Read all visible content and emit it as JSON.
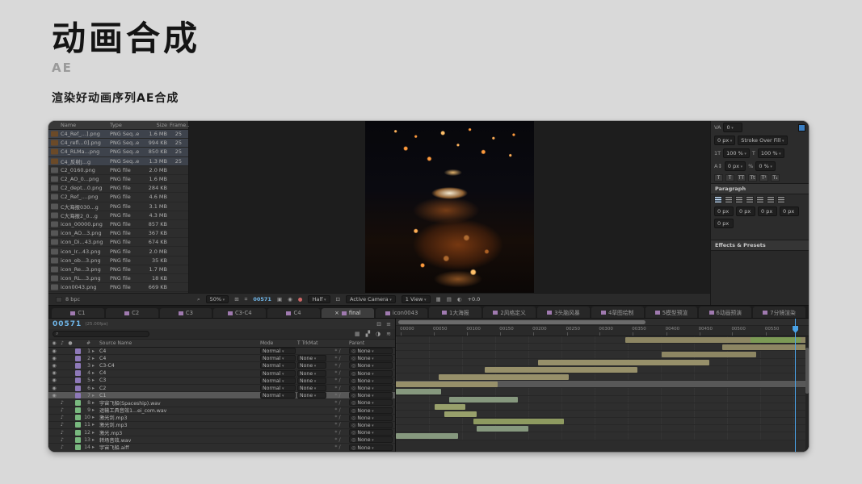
{
  "slide": {
    "title": "动画合成",
    "subtitle": "AE",
    "description": "渲染好动画序列AE合成"
  },
  "icons": {
    "magnification": "⌕",
    "grid": "⊞",
    "mask_visibility": "⌗",
    "snapshot": "▣",
    "show_snapshot": "◉",
    "channels": "●",
    "roi": "⊡",
    "pixel_aspect": "▦",
    "fast_previews": "▤",
    "exposure_icon": "◐",
    "search": "⌕",
    "eye": "◉",
    "audio": "♪",
    "solo": "●",
    "comp_flowchart": "⊟",
    "draft3d": "▦",
    "frame_blend": "▞",
    "motion_blur": "◑",
    "graph_editor": "≋",
    "menu": "≡"
  },
  "project": {
    "columns": {
      "name": "Name",
      "type": "Type",
      "size": "Size",
      "frames": "Frame..."
    },
    "footer": "8 bpc",
    "files": [
      {
        "name": "C4_Ref_...].png",
        "type": "PNG Seq..e",
        "size": "1.6 MB",
        "frames": "25",
        "bg": "#3e434c",
        "thumb": "#6b4a28"
      },
      {
        "name": "C4_refl...0].png",
        "type": "PNG Seq..e",
        "size": "994 KB",
        "frames": "25",
        "bg": "#3e434c",
        "thumb": "#6b4a28"
      },
      {
        "name": "C4_RLMa...png",
        "type": "PNG Seq..e",
        "size": "850 KB",
        "frames": "25",
        "bg": "#3e434c",
        "thumb": "#6b4a28"
      },
      {
        "name": "C4_反射J...g",
        "type": "PNG Seq..e",
        "size": "1.3 MB",
        "frames": "25",
        "bg": "#3e434c",
        "thumb": "#6b4a28"
      },
      {
        "name": "C2_0160.png",
        "type": "PNG file",
        "size": "2.0 MB",
        "frames": "",
        "thumb": "#565656"
      },
      {
        "name": "C2_AO_0...png",
        "type": "PNG file",
        "size": "1.6 MB",
        "frames": "",
        "thumb": "#565656"
      },
      {
        "name": "C2_dept...0.png",
        "type": "PNG file",
        "size": "284 KB",
        "frames": "",
        "thumb": "#565656"
      },
      {
        "name": "C2_Ref_....png",
        "type": "PNG file",
        "size": "4.6 MB",
        "frames": "",
        "thumb": "#565656"
      },
      {
        "name": "C大海报030...g",
        "type": "PNG file",
        "size": "3.1 MB",
        "frames": "",
        "thumb": "#565656"
      },
      {
        "name": "C大海报2_0...g",
        "type": "PNG file",
        "size": "4.3 MB",
        "frames": "",
        "thumb": "#565656"
      },
      {
        "name": "icon_00000.png",
        "type": "PNG file",
        "size": "857 KB",
        "frames": "",
        "thumb": "#565656"
      },
      {
        "name": "icon_AO...3.png",
        "type": "PNG file",
        "size": "367 KB",
        "frames": "",
        "thumb": "#565656"
      },
      {
        "name": "icon_Di...43.png",
        "type": "PNG file",
        "size": "674 KB",
        "frames": "",
        "thumb": "#565656"
      },
      {
        "name": "icon_Ir...43.png",
        "type": "PNG file",
        "size": "2.0 MB",
        "frames": "",
        "thumb": "#565656"
      },
      {
        "name": "icon_ob...3.png",
        "type": "PNG file",
        "size": "35 KB",
        "frames": "",
        "thumb": "#565656"
      },
      {
        "name": "icon_Re...3.png",
        "type": "PNG file",
        "size": "1.7 MB",
        "frames": "",
        "thumb": "#565656"
      },
      {
        "name": "icon_RL...3.png",
        "type": "PNG file",
        "size": "18 KB",
        "frames": "",
        "thumb": "#565656"
      },
      {
        "name": "icon0043.png",
        "type": "PNG file",
        "size": "669 KB",
        "frames": "",
        "thumb": "#565656"
      }
    ]
  },
  "viewer": {
    "zoom": "50%",
    "frame": "00571",
    "resolution": "Half",
    "camera": "Active Camera",
    "view": "1 View",
    "exposure": "+0.0"
  },
  "character_panel": {
    "kerning_label": "VA",
    "kerning_value": "0",
    "fill_color": "#3a7ec2",
    "stroke_width": "0 px",
    "stroke_style": "Stroke Over Fill",
    "vscale_label": "1T",
    "vscale": "100 %",
    "hscale_label": "T",
    "hscale": "100 %",
    "baseline_label": "A↕",
    "baseline": "0 px",
    "tsume_label": "%",
    "tsume": "0 %",
    "style_buttons": [
      {
        "g": "T"
      },
      {
        "g": "T"
      },
      {
        "g": "TT"
      },
      {
        "g": "Tt"
      },
      {
        "g": "T¹"
      },
      {
        "g": "T₁"
      }
    ],
    "paragraph_label": "Paragraph",
    "indents": [
      {
        "v": "0 px"
      },
      {
        "v": "0 px"
      },
      {
        "v": "0 px"
      },
      {
        "v": "0 px"
      },
      {
        "v": "0 px"
      }
    ],
    "effects_label": "Effects & Presets"
  },
  "comp_tabs": [
    {
      "label": "C1",
      "close": "",
      "bg": "#272727",
      "fg": "#9a9a9a"
    },
    {
      "label": "C2",
      "close": "",
      "bg": "#272727",
      "fg": "#9a9a9a"
    },
    {
      "label": "C3",
      "close": "",
      "bg": "#272727",
      "fg": "#9a9a9a"
    },
    {
      "label": "C3-C4",
      "close": "",
      "bg": "#272727",
      "fg": "#9a9a9a"
    },
    {
      "label": "C4",
      "close": "",
      "bg": "#272727",
      "fg": "#9a9a9a"
    },
    {
      "label": "final",
      "close": "×",
      "bg": "#3d3d3d",
      "fg": "#d6d6d6"
    },
    {
      "label": "icon0043",
      "close": "",
      "bg": "#272727",
      "fg": "#9a9a9a"
    },
    {
      "label": "1大海报",
      "close": "",
      "bg": "#272727",
      "fg": "#9a9a9a"
    },
    {
      "label": "2风格定义",
      "close": "",
      "bg": "#272727",
      "fg": "#9a9a9a"
    },
    {
      "label": "3头脑风暴",
      "close": "",
      "bg": "#272727",
      "fg": "#9a9a9a"
    },
    {
      "label": "4草图绘制",
      "close": "",
      "bg": "#272727",
      "fg": "#9a9a9a"
    },
    {
      "label": "5模型预渲",
      "close": "",
      "bg": "#272727",
      "fg": "#9a9a9a"
    },
    {
      "label": "6动画预演",
      "close": "",
      "bg": "#272727",
      "fg": "#9a9a9a"
    },
    {
      "label": "7分镜渲染",
      "close": "",
      "bg": "#272727",
      "fg": "#9a9a9a"
    }
  ],
  "timeline": {
    "timecode": "00571",
    "fps_note": "(25.00fps)",
    "playhead_left": "96.7%",
    "columns": {
      "num": "#",
      "source": "Source Name",
      "mode": "Mode",
      "trkmat": "T TrkMat",
      "parent": "Parent"
    },
    "ruler": [
      {
        "label": "00000",
        "left": "1.0%"
      },
      {
        "label": "00050",
        "left": "9.0%"
      },
      {
        "label": "00100",
        "left": "17.1%"
      },
      {
        "label": "00150",
        "left": "25.1%"
      },
      {
        "label": "00200",
        "left": "33.1%"
      },
      {
        "label": "00250",
        "left": "41.2%"
      },
      {
        "label": "00300",
        "left": "49.2%"
      },
      {
        "label": "00350",
        "left": "57.2%"
      },
      {
        "label": "00400",
        "left": "65.3%"
      },
      {
        "label": "00450",
        "left": "73.3%"
      },
      {
        "label": "00500",
        "left": "81.3%"
      },
      {
        "label": "00550",
        "left": "89.4%"
      }
    ],
    "layers": [
      {
        "num": "1",
        "name": "C4",
        "v": "◉",
        "a": "",
        "mode": "Normal",
        "trkmat": "",
        "parent": "None",
        "chip": "#8e79b9",
        "bar_left": "55.5%",
        "bar_width": "44%",
        "bar_color": "#8d8663",
        "bar2_left": "86%",
        "bar2_width": "12%",
        "bar2_color": "#7c9a55"
      },
      {
        "num": "2",
        "name": "C4",
        "v": "◉",
        "a": "",
        "mode": "Normal",
        "trkmat": "None",
        "parent": "None",
        "chip": "#8e79b9",
        "bar_left": "79%",
        "bar_width": "21%",
        "bar_color": "#8d8663"
      },
      {
        "num": "3",
        "name": "C3-C4",
        "v": "◉",
        "a": "",
        "mode": "Normal",
        "trkmat": "None",
        "parent": "None",
        "chip": "#8e79b9",
        "bar_left": "64.3%",
        "bar_width": "23%",
        "bar_color": "#8d8663"
      },
      {
        "num": "4",
        "name": "C4",
        "v": "◉",
        "a": "",
        "mode": "Normal",
        "trkmat": "None",
        "parent": "None",
        "chip": "#8e79b9",
        "bar_left": "34.5%",
        "bar_width": "41.5%",
        "bar_color": "#97906a"
      },
      {
        "num": "5",
        "name": "C3",
        "v": "◉",
        "a": "",
        "mode": "Normal",
        "trkmat": "None",
        "parent": "None",
        "chip": "#8e79b9",
        "bar_left": "21.6%",
        "bar_width": "37%",
        "bar_color": "#97906a"
      },
      {
        "num": "6",
        "name": "C2",
        "v": "◉",
        "a": "",
        "mode": "Normal",
        "trkmat": "None",
        "parent": "None",
        "chip": "#8e79b9",
        "bar_left": "10.4%",
        "bar_width": "31.5%",
        "bar_color": "#97906a"
      },
      {
        "num": "7",
        "name": "C1",
        "v": "◉",
        "a": "",
        "mode": "Normal",
        "trkmat": "None",
        "parent": "None",
        "chip": "#8e79b9",
        "rowbg": "#585858",
        "bar_left": "0%",
        "bar_width": "24.7%",
        "bar_color": "#97906a"
      },
      {
        "num": "8",
        "name": "宇宙飞船(Spaceship).wav",
        "v": "",
        "a": "♪",
        "mode": "",
        "trkmat": "",
        "parent": "None",
        "chip": "#79b97f",
        "bar_left": "0%",
        "bar_width": "11%",
        "bar_color": "#86987e"
      },
      {
        "num": "9",
        "name": "运输工具音效1...ei_com.wav",
        "v": "",
        "a": "♪",
        "mode": "",
        "trkmat": "",
        "parent": "None",
        "chip": "#79b97f",
        "bar_left": "13%",
        "bar_width": "16.5%",
        "bar_color": "#86987e"
      },
      {
        "num": "10",
        "name": "激光剑.mp3",
        "v": "",
        "a": "♪",
        "mode": "",
        "trkmat": "",
        "parent": "None",
        "chip": "#79b97f",
        "bar_left": "9.4%",
        "bar_width": "7.5%",
        "bar_color": "#98a06b"
      },
      {
        "num": "11",
        "name": "激光剑.mp3",
        "v": "",
        "a": "♪",
        "mode": "",
        "trkmat": "",
        "parent": "None",
        "chip": "#79b97f",
        "bar_left": "11.8%",
        "bar_width": "7.8%",
        "bar_color": "#98a06b"
      },
      {
        "num": "12",
        "name": "激光.mp3",
        "v": "",
        "a": "♪",
        "mode": "",
        "trkmat": "",
        "parent": "None",
        "chip": "#79b97f",
        "bar_left": "18.8%",
        "bar_width": "22%",
        "bar_color": "#8e9a60"
      },
      {
        "num": "13",
        "name": "转场音效.wav",
        "v": "",
        "a": "♪",
        "mode": "",
        "trkmat": "",
        "parent": "None",
        "chip": "#79b97f",
        "bar_left": "19.6%",
        "bar_width": "12.4%",
        "bar_color": "#86987e"
      },
      {
        "num": "14",
        "name": "宇宙飞船.aiff",
        "v": "",
        "a": "♪",
        "mode": "",
        "trkmat": "",
        "parent": "None",
        "chip": "#79b97f",
        "bar_left": "0%",
        "bar_width": "15%",
        "bar_color": "#86987e"
      }
    ]
  }
}
